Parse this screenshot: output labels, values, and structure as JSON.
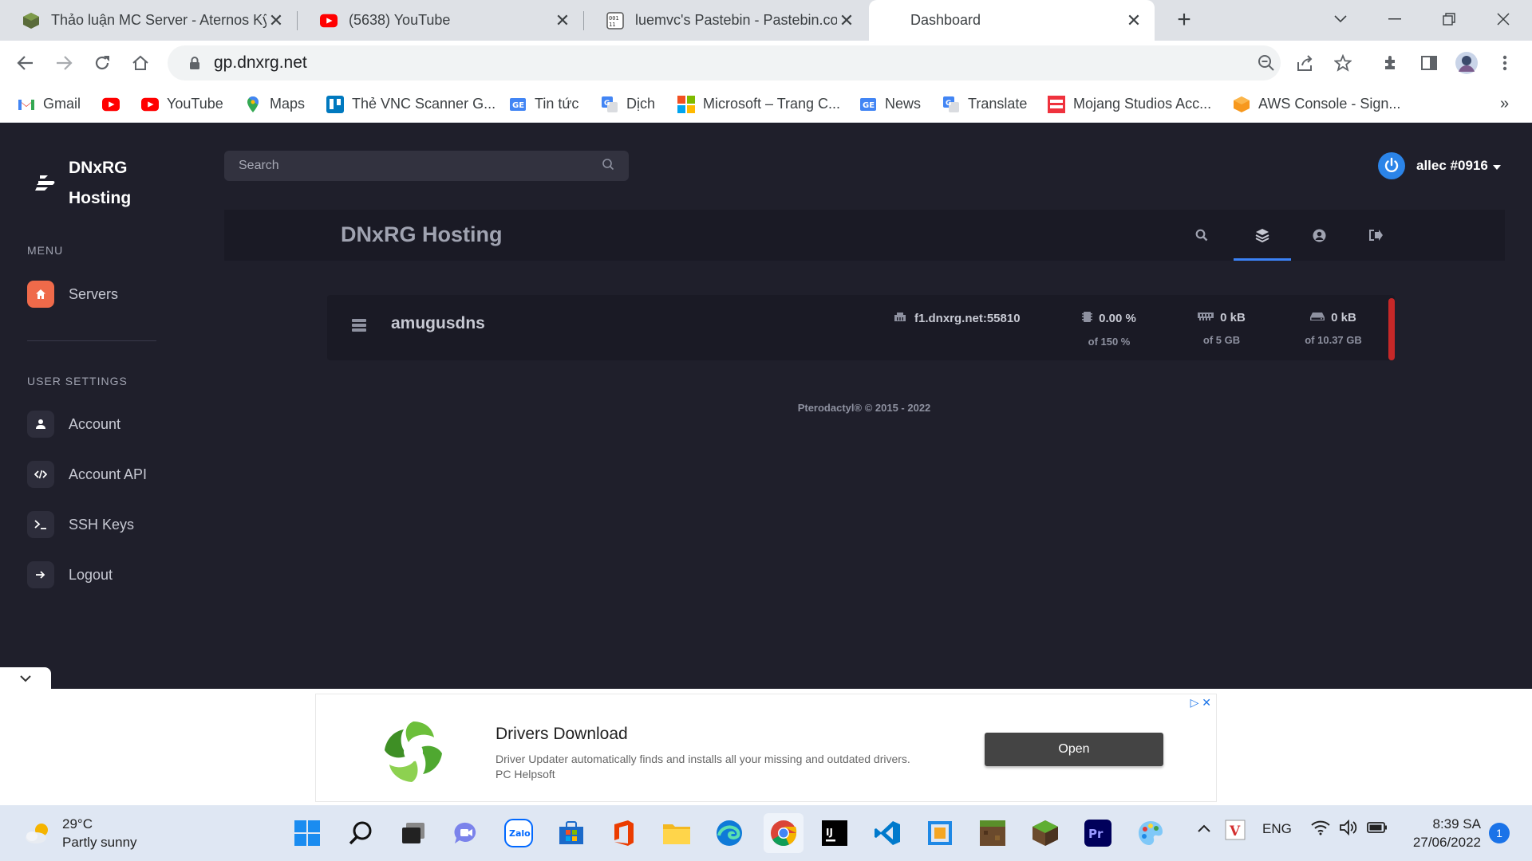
{
  "browser": {
    "tabs": [
      {
        "title": "Thảo luận MC Server - Aternos Kỹ",
        "icon": "aternos-icon"
      },
      {
        "title": "(5638) YouTube",
        "icon": "youtube-icon"
      },
      {
        "title": "luemvc's Pastebin - Pastebin.com",
        "icon": "pastebin-icon"
      },
      {
        "title": "Dashboard",
        "icon": "dashboard-icon",
        "active": true
      }
    ],
    "url": "gp.dnxrg.net",
    "bookmarks": [
      {
        "label": "Gmail",
        "icon": "gmail-icon"
      },
      {
        "label": "",
        "icon": "youtube-icon"
      },
      {
        "label": "YouTube",
        "icon": "youtube-icon"
      },
      {
        "label": "Maps",
        "icon": "maps-icon"
      },
      {
        "label": "Thẻ VNC Scanner G...",
        "icon": "trello-icon"
      },
      {
        "label": "Tin tức",
        "icon": "news-icon"
      },
      {
        "label": "Dịch",
        "icon": "translate-icon"
      },
      {
        "label": "Microsoft – Trang C...",
        "icon": "microsoft-icon"
      },
      {
        "label": "News",
        "icon": "news-icon"
      },
      {
        "label": "Translate",
        "icon": "translate-icon"
      },
      {
        "label": "Mojang Studios Acc...",
        "icon": "mojang-icon"
      },
      {
        "label": "AWS Console - Sign...",
        "icon": "aws-icon"
      }
    ],
    "more_bookmarks": "»"
  },
  "sidebar": {
    "brand_line1": "DNxRG",
    "brand_line2": "Hosting",
    "menu_label": "MENU",
    "menu_items": [
      {
        "label": "Servers",
        "icon": "home-icon"
      }
    ],
    "user_settings_label": "USER SETTINGS",
    "settings_items": [
      {
        "label": "Account",
        "icon": "user-icon"
      },
      {
        "label": "Account API",
        "icon": "code-icon"
      },
      {
        "label": "SSH Keys",
        "icon": "terminal-icon"
      },
      {
        "label": "Logout",
        "icon": "logout-icon"
      }
    ]
  },
  "header": {
    "search_placeholder": "Search",
    "username": "allec #0916"
  },
  "subheader": {
    "title": "DNxRG Hosting"
  },
  "server": {
    "name": "amugusdns",
    "address": "f1.dnxrg.net:55810",
    "cpu": {
      "value": "0.00 %",
      "limit": "of 150 %"
    },
    "memory": {
      "value": "0 kB",
      "limit": "of 5 GB"
    },
    "disk": {
      "value": "0 kB",
      "limit": "of 10.37 GB"
    },
    "status_color": "#c62828"
  },
  "footer": "Pterodactyl® © 2015 - 2022",
  "ad": {
    "title": "Drivers Download",
    "description": "Driver Updater automatically finds and installs all your missing and outdated drivers. PC Helpsoft",
    "button": "Open"
  },
  "taskbar": {
    "temperature": "29°C",
    "weather": "Partly sunny",
    "language": "ENG",
    "time": "8:39 SA",
    "date": "27/06/2022",
    "notifications": "1"
  },
  "colors": {
    "accent": "#3b82f6",
    "servers_icon": "#ef6a4a",
    "background": "#1f1f2b"
  }
}
